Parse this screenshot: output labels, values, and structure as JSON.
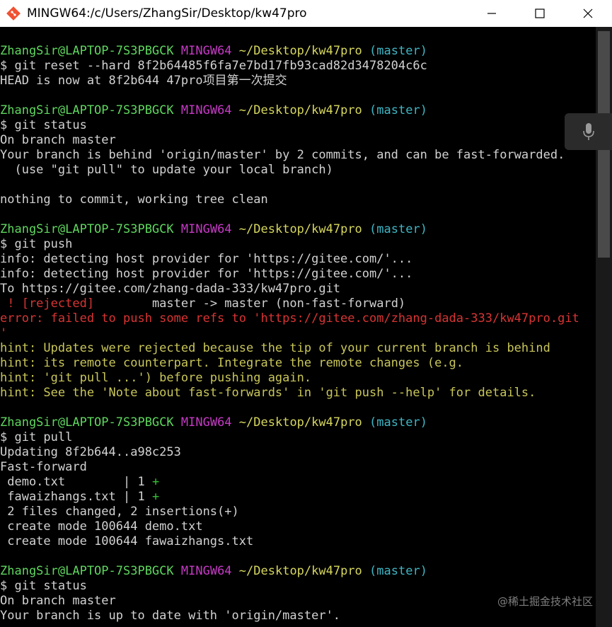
{
  "window": {
    "title": "MINGW64:/c/Users/ZhangSir/Desktop/kw47pro",
    "controls": [
      "minimize",
      "maximize",
      "close"
    ]
  },
  "colors": {
    "prompt_user": "#5fd75f",
    "prompt_env": "#c639c6",
    "prompt_path": "#d7d75f",
    "prompt_branch": "#3fb7c6",
    "error": "#d93434",
    "hint": "#c9c65a",
    "diff_plus": "#34c134",
    "text": "#c0c0c0"
  },
  "prompt": {
    "user": "ZhangSir@LAPTOP-7S3PBGCK",
    "env": "MINGW64",
    "path": "~/Desktop/kw47pro",
    "branch": "(master)"
  },
  "session": {
    "block1": {
      "cmd": "$ git reset --hard 8f2b64485f6fa7e7bd17fb93cad82d3478204c6c",
      "out": "HEAD is now at 8f2b644 47pro项目第一次提交"
    },
    "block2": {
      "cmd": "$ git status",
      "out1": "On branch master",
      "out2": "Your branch is behind 'origin/master' by 2 commits, and can be fast-forwarded.",
      "out3": "  (use \"git pull\" to update your local branch)",
      "out4": "nothing to commit, working tree clean"
    },
    "block3": {
      "cmd": "$ git push",
      "info1": "info: detecting host provider for 'https://gitee.com/'...",
      "info2": "info: detecting host provider for 'https://gitee.com/'...",
      "to": "To https://gitee.com/zhang-dada-333/kw47pro.git",
      "rejected": " ! [rejected]",
      "rejected_rest": "        master -> master (non-fast-forward)",
      "error": "error: failed to push some refs to 'https://gitee.com/zhang-dada-333/kw47pro.git",
      "error_tail": "'",
      "hint1": "hint: Updates were rejected because the tip of your current branch is behind",
      "hint2": "hint: its remote counterpart. Integrate the remote changes (e.g.",
      "hint3": "hint: 'git pull ...') before pushing again.",
      "hint4": "hint: See the 'Note about fast-forwards' in 'git push --help' for details."
    },
    "block4": {
      "cmd": "$ git pull",
      "out1": "Updating 8f2b644..a98c253",
      "out2": "Fast-forward",
      "file1": " demo.txt        | 1 ",
      "file1_plus": "+",
      "file2": " fawaizhangs.txt | 1 ",
      "file2_plus": "+",
      "summary": " 2 files changed, 2 insertions(+)",
      "create1": " create mode 100644 demo.txt",
      "create2": " create mode 100644 fawaizhangs.txt"
    },
    "block5": {
      "cmd": "$ git status",
      "out1": "On branch master",
      "out2": "Your branch is up to date with 'origin/master'."
    }
  },
  "watermark": "@稀土掘金技术社区",
  "icons": {
    "app": "git-bash-icon",
    "minimize": "minimize-icon",
    "maximize": "maximize-icon",
    "close": "close-icon",
    "mic": "microphone-icon"
  }
}
